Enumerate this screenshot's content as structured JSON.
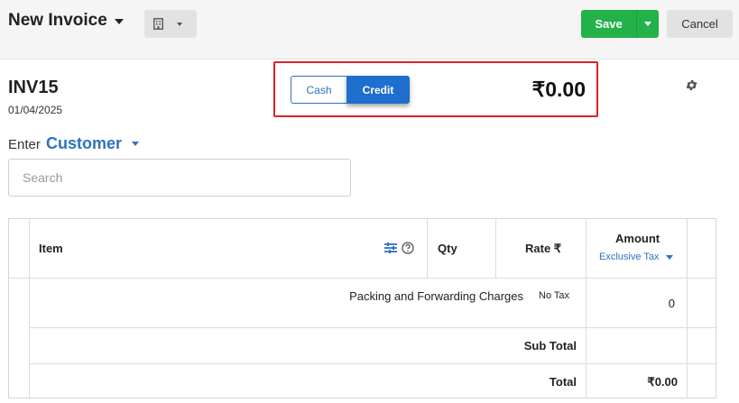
{
  "header": {
    "title": "New Invoice",
    "save_label": "Save",
    "cancel_label": "Cancel"
  },
  "invoice": {
    "number": "INV15",
    "date": "01/04/2025",
    "total": "₹0.00"
  },
  "payment_type": {
    "cash_label": "Cash",
    "credit_label": "Credit",
    "selected": "Credit"
  },
  "customer": {
    "prefix": "Enter",
    "label": "Customer",
    "search_placeholder": "Search"
  },
  "table": {
    "headers": {
      "item": "Item",
      "qty": "Qty",
      "rate": "Rate ₹",
      "amount": "Amount",
      "tax_mode": "Exclusive Tax"
    },
    "rows": [
      {
        "description": "Packing and Forwarding Charges",
        "tax": "No Tax",
        "amount": "0"
      }
    ],
    "subtotal_label": "Sub Total",
    "total_label": "Total",
    "total_value": "₹0.00"
  },
  "colors": {
    "accent": "#2e72c0",
    "save": "#23b249",
    "highlight": "#d9232e"
  }
}
